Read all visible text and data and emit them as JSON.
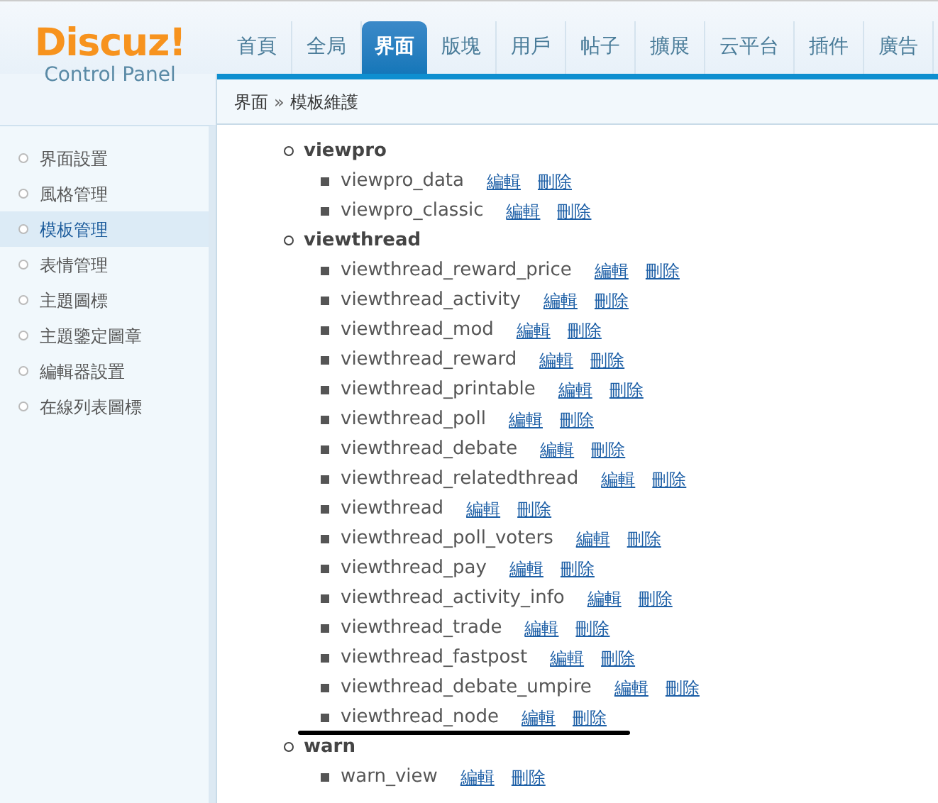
{
  "logo": {
    "name": "Discuz!",
    "subtitle": "Control Panel"
  },
  "tabs": [
    {
      "label": "首頁",
      "selected": false
    },
    {
      "label": "全局",
      "selected": false
    },
    {
      "label": "界面",
      "selected": true
    },
    {
      "label": "版塊",
      "selected": false
    },
    {
      "label": "用戶",
      "selected": false
    },
    {
      "label": "帖子",
      "selected": false
    },
    {
      "label": "擴展",
      "selected": false
    },
    {
      "label": "云平台",
      "selected": false
    },
    {
      "label": "插件",
      "selected": false
    },
    {
      "label": "廣告",
      "selected": false
    }
  ],
  "breadcrumb": {
    "section": "界面",
    "separator": "»",
    "page": "模板維護"
  },
  "sidebar": {
    "items": [
      {
        "label": "界面設置",
        "selected": false
      },
      {
        "label": "風格管理",
        "selected": false
      },
      {
        "label": "模板管理",
        "selected": true
      },
      {
        "label": "表情管理",
        "selected": false
      },
      {
        "label": "主題圖標",
        "selected": false
      },
      {
        "label": "主題鑒定圖章",
        "selected": false
      },
      {
        "label": "編輯器設置",
        "selected": false
      },
      {
        "label": "在線列表圖標",
        "selected": false
      }
    ]
  },
  "templates": [
    {
      "name": "viewpro",
      "children": [
        {
          "name": "viewpro_data",
          "edit": "編輯",
          "delete": "刪除",
          "underlined": false
        },
        {
          "name": "viewpro_classic",
          "edit": "編輯",
          "delete": "刪除",
          "underlined": false
        }
      ]
    },
    {
      "name": "viewthread",
      "children": [
        {
          "name": "viewthread_reward_price",
          "edit": "編輯",
          "delete": "刪除",
          "underlined": false
        },
        {
          "name": "viewthread_activity",
          "edit": "編輯",
          "delete": "刪除",
          "underlined": false
        },
        {
          "name": "viewthread_mod",
          "edit": "編輯",
          "delete": "刪除",
          "underlined": false
        },
        {
          "name": "viewthread_reward",
          "edit": "編輯",
          "delete": "刪除",
          "underlined": false
        },
        {
          "name": "viewthread_printable",
          "edit": "編輯",
          "delete": "刪除",
          "underlined": false
        },
        {
          "name": "viewthread_poll",
          "edit": "編輯",
          "delete": "刪除",
          "underlined": false
        },
        {
          "name": "viewthread_debate",
          "edit": "編輯",
          "delete": "刪除",
          "underlined": false
        },
        {
          "name": "viewthread_relatedthread",
          "edit": "編輯",
          "delete": "刪除",
          "underlined": false
        },
        {
          "name": "viewthread",
          "edit": "編輯",
          "delete": "刪除",
          "underlined": false
        },
        {
          "name": "viewthread_poll_voters",
          "edit": "編輯",
          "delete": "刪除",
          "underlined": false
        },
        {
          "name": "viewthread_pay",
          "edit": "編輯",
          "delete": "刪除",
          "underlined": false
        },
        {
          "name": "viewthread_activity_info",
          "edit": "編輯",
          "delete": "刪除",
          "underlined": false
        },
        {
          "name": "viewthread_trade",
          "edit": "編輯",
          "delete": "刪除",
          "underlined": false
        },
        {
          "name": "viewthread_fastpost",
          "edit": "編輯",
          "delete": "刪除",
          "underlined": false
        },
        {
          "name": "viewthread_debate_umpire",
          "edit": "編輯",
          "delete": "刪除",
          "underlined": false
        },
        {
          "name": "viewthread_node",
          "edit": "編輯",
          "delete": "刪除",
          "underlined": true
        }
      ]
    },
    {
      "name": "warn",
      "children": [
        {
          "name": "warn_view",
          "edit": "編輯",
          "delete": "刪除",
          "underlined": false
        }
      ]
    }
  ]
}
